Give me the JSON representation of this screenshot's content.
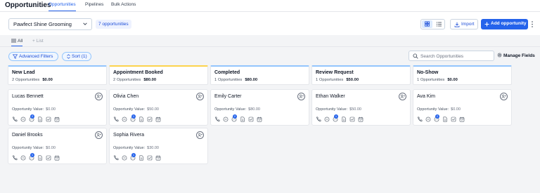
{
  "app": {
    "title": "Opportunities"
  },
  "top_tabs": [
    {
      "label": "Opportunities",
      "active": true
    },
    {
      "label": "Pipelines",
      "active": false
    },
    {
      "label": "Bulk Actions",
      "active": false
    }
  ],
  "toolbar": {
    "pipeline_selected": "Pawfect Shine Grooming",
    "opportunity_count": "7 opportunities",
    "import_label": "Import",
    "add_label": "Add opportunity"
  },
  "views": {
    "all_label": "All",
    "list_label": "List"
  },
  "filters": {
    "advanced_label": "Advanced Filters",
    "sort_label": "Sort (1)",
    "search_placeholder": "Search Opportunities",
    "manage_fields_label": "Manage Fields"
  },
  "card_value_label": "Opportunity Value:",
  "stages": [
    {
      "name": "New Lead",
      "count_text": "2 Opportunities",
      "total": "$0.00",
      "accent": "#93c5fd"
    },
    {
      "name": "Appointment Booked",
      "count_text": "2 Opportunities",
      "total": "$80.00",
      "accent": "#fcd34d"
    },
    {
      "name": "Completed",
      "count_text": "1 Opportunities",
      "total": "$80.00",
      "accent": "#93c5fd"
    },
    {
      "name": "Review Request",
      "count_text": "1 Opportunities",
      "total": "$50.00",
      "accent": "#93c5fd"
    },
    {
      "name": "No-Show",
      "count_text": "1 Opportunities",
      "total": "$0.00",
      "accent": "#93c5fd"
    }
  ],
  "cards": [
    {
      "name": "Lucas Bennett",
      "value": "$0.00",
      "badge": "2"
    },
    {
      "name": "Olivia Chen",
      "value": "$50.00",
      "badge": "1"
    },
    {
      "name": "Emily Carter",
      "value": "$80.00",
      "badge": "2"
    },
    {
      "name": "Ethan Walker",
      "value": "$50.00",
      "badge": "1"
    },
    {
      "name": "Ava Kim",
      "value": "$0.00",
      "badge": "2"
    },
    {
      "name": "Daniel Brooks",
      "value": "$0.00",
      "badge": "1"
    },
    {
      "name": "Sophia Rivera",
      "value": "$30.00",
      "badge": "1"
    }
  ],
  "icons": {
    "card_actions": [
      "phone-icon",
      "chat-icon",
      "message-icon",
      "document-icon",
      "checkbox-icon",
      "calendar-icon"
    ],
    "accent_color": "#2563eb"
  }
}
